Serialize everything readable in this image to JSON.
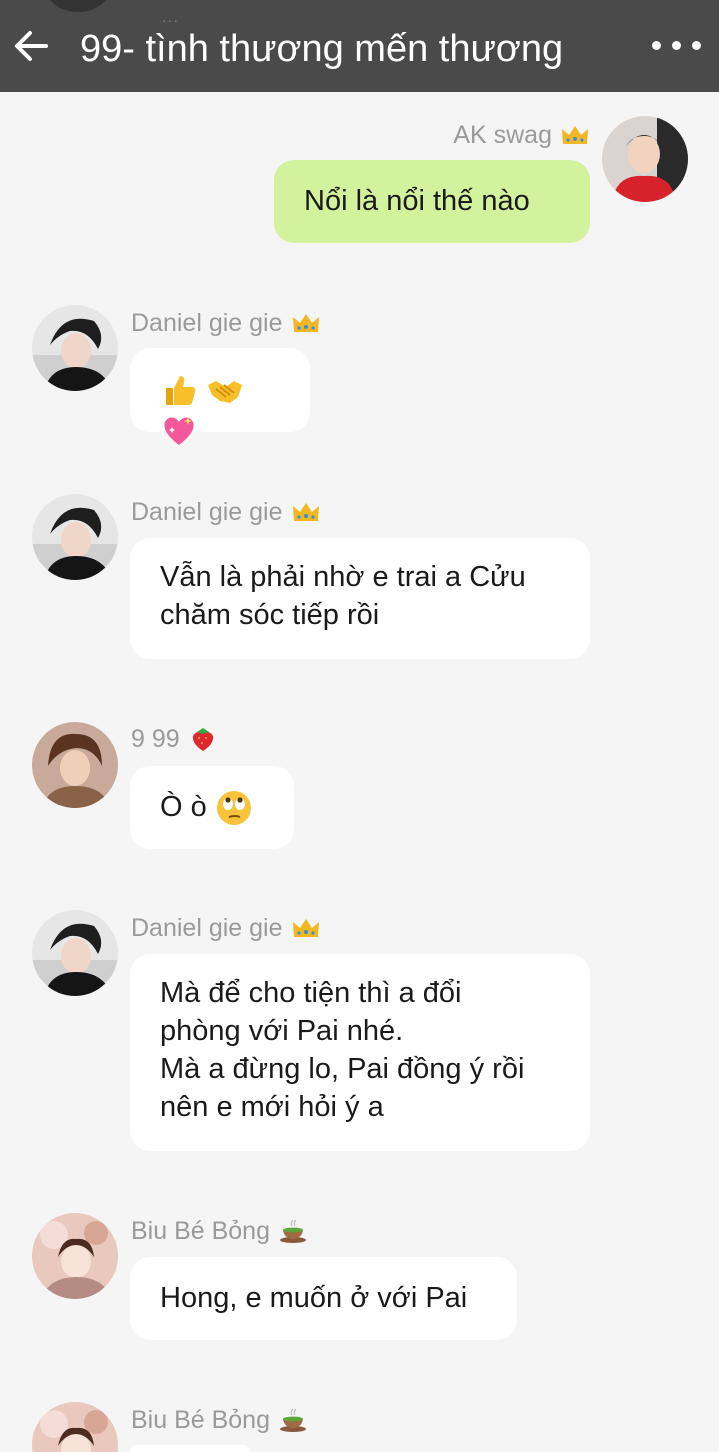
{
  "header": {
    "title": "99- tình thương mến thương",
    "back_icon": "arrow-left-icon",
    "more_icon": "more-dots-icon",
    "background": "#4a4a4a"
  },
  "colors": {
    "page_bg": "#f5f5f5",
    "my_bubble": "#d3f29d",
    "other_bubble": "#ffffff",
    "sender_name": "#9a9a9a"
  },
  "messages": [
    {
      "sender": "AK swag",
      "badge": "crown-icon",
      "text": "Nổi là nổi thế nào",
      "mine": true
    },
    {
      "sender": "Daniel gie gie",
      "badge": "crown-icon",
      "text": "",
      "emoji": [
        "thumbs-up-icon",
        "handshake-icon",
        "sparkling-heart-icon"
      ],
      "mine": false
    },
    {
      "sender": "Daniel gie gie",
      "badge": "crown-icon",
      "lines": [
        "Vẫn là phải nhờ e trai a Cửu",
        "chăm sóc tiếp rồi"
      ],
      "mine": false
    },
    {
      "sender": "9 99",
      "badge": "strawberry-icon",
      "text": "Ò ò",
      "emoji": [
        "eye-roll-face-icon"
      ],
      "mine": false
    },
    {
      "sender": "Daniel gie gie",
      "badge": "crown-icon",
      "lines": [
        "Mà để cho tiện thì a đổi",
        "phòng với Pai nhé.",
        "Mà a đừng lo, Pai đồng ý rồi",
        "nên e mới hỏi ý a"
      ],
      "mine": false
    },
    {
      "sender": "Biu Bé Bỏng",
      "badge": "tea-cup-icon",
      "text": "Hong, e muốn ở với Pai",
      "mine": false
    },
    {
      "sender": "Biu Bé Bỏng",
      "badge": "tea-cup-icon",
      "text": "",
      "mine": false
    }
  ]
}
